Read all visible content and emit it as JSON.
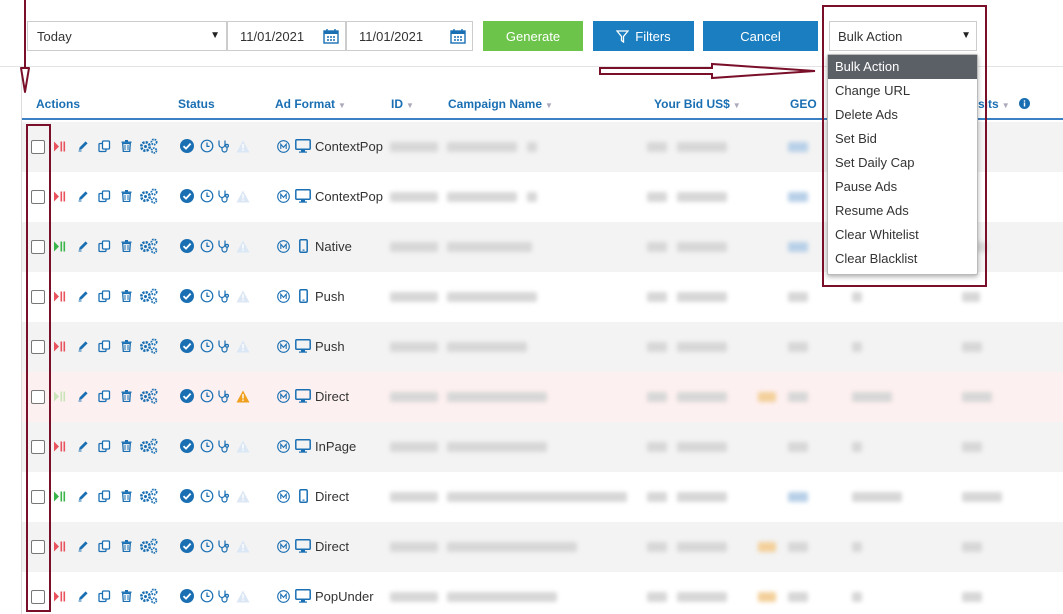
{
  "toolbar": {
    "period": "Today",
    "date_from": "11/01/2021",
    "date_to": "11/01/2021",
    "generate_label": "Generate",
    "filters_label": "Filters",
    "cancel_label": "Cancel",
    "bulk_action_selected": "Bulk Action"
  },
  "bulk_menu": {
    "options": [
      "Bulk Action",
      "Change URL",
      "Delete Ads",
      "Set Bid",
      "Set Daily Cap",
      "Pause Ads",
      "Resume Ads",
      "Clear Whitelist",
      "Clear Blacklist"
    ]
  },
  "table": {
    "headers": {
      "actions": "Actions",
      "status": "Status",
      "ad_format": "Ad Format",
      "id": "ID",
      "campaign_name": "Campaign Name",
      "your_bid": "Your Bid US$",
      "geo": "GEO",
      "visits": "sits"
    },
    "rows": [
      {
        "format": "ContextPop",
        "device": "desktop",
        "play": "red",
        "warning": false
      },
      {
        "format": "ContextPop",
        "device": "desktop",
        "play": "red",
        "warning": false
      },
      {
        "format": "Native",
        "device": "mobile",
        "play": "green",
        "warning": false
      },
      {
        "format": "Push",
        "device": "mobile",
        "play": "red",
        "warning": false
      },
      {
        "format": "Push",
        "device": "desktop",
        "play": "red",
        "warning": false
      },
      {
        "format": "Direct",
        "device": "desktop",
        "play": "faded",
        "warning": true
      },
      {
        "format": "InPage",
        "device": "desktop",
        "play": "red",
        "warning": false
      },
      {
        "format": "Direct",
        "device": "mobile",
        "play": "green",
        "warning": false
      },
      {
        "format": "Direct",
        "device": "desktop",
        "play": "red",
        "warning": false
      },
      {
        "format": "PopUnder",
        "device": "desktop",
        "play": "red",
        "warning": false
      }
    ]
  },
  "colors": {
    "accent": "#1a7ec0",
    "generate": "#6cc54a",
    "header_text": "#1a6fb3",
    "annotation": "#7a0f2a",
    "menu_selected": "#5b5f66"
  }
}
